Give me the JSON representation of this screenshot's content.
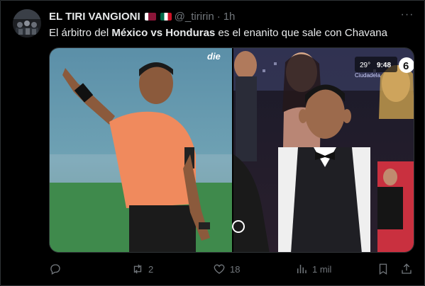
{
  "tweet": {
    "display_name": "EL TIRI VANGIONI",
    "handle": "@_tiririn",
    "separator": "·",
    "time": "1h",
    "text_parts": [
      "El árbitro del ",
      "México vs Honduras",
      " es el enanito que sale con Chavana"
    ],
    "more_label": "···",
    "media": {
      "left_watermark": "die",
      "right_clock_temp": "29°",
      "right_clock_time": "9:48",
      "right_channel": "6",
      "right_overlay_caption": "Ciudadela"
    },
    "actions": {
      "reply_count": "",
      "retweet_count": "2",
      "like_count": "18",
      "views_count": "1 mil"
    }
  },
  "icons": [
    "avatar-image",
    "flag-qatar-icon",
    "flag-mexico-icon",
    "more-icon",
    "reply-icon",
    "retweet-icon",
    "like-icon",
    "views-icon",
    "bookmark-icon",
    "share-icon"
  ],
  "colors": {
    "background": "#000000",
    "text": "#e7e9ea",
    "muted": "#71767b",
    "border": "#2f3336"
  }
}
